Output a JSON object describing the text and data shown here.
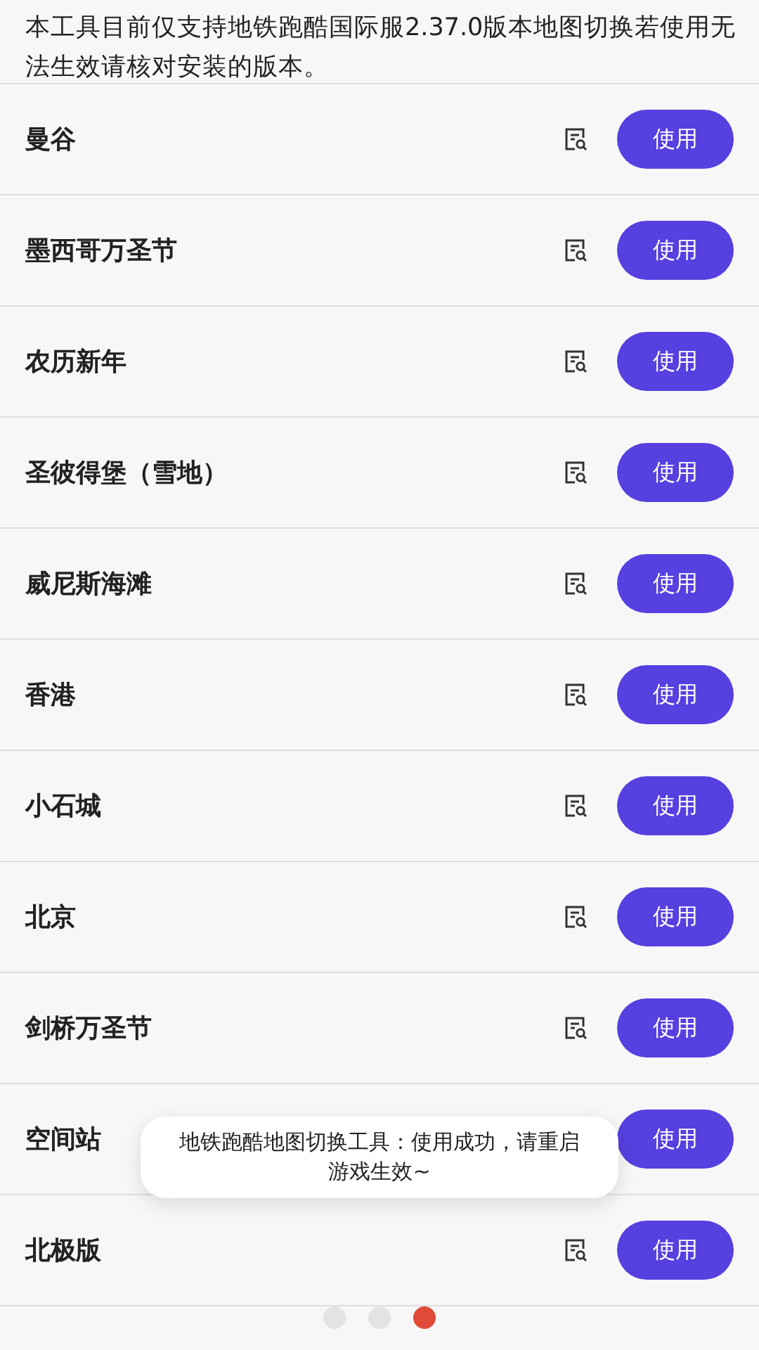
{
  "notice": "本工具目前仅支持地铁跑酷国际服2.37.0版本地图切换若使用无法生效请核对安装的版本。",
  "maps": [
    {
      "name": "曼谷",
      "preview": true,
      "button": "使用"
    },
    {
      "name": "墨西哥万圣节",
      "preview": true,
      "button": "使用"
    },
    {
      "name": "农历新年",
      "preview": true,
      "button": "使用"
    },
    {
      "name": "圣彼得堡（雪地）",
      "preview": true,
      "button": "使用"
    },
    {
      "name": "威尼斯海滩",
      "preview": true,
      "button": "使用"
    },
    {
      "name": "香港",
      "preview": true,
      "button": "使用"
    },
    {
      "name": "小石城",
      "preview": true,
      "button": "使用"
    },
    {
      "name": "北京",
      "preview": true,
      "button": "使用"
    },
    {
      "name": "剑桥万圣节",
      "preview": true,
      "button": "使用"
    },
    {
      "name": "空间站",
      "preview": false,
      "button": "使用"
    },
    {
      "name": "北极版",
      "preview": true,
      "button": "使用"
    }
  ],
  "toast": "地铁跑酷地图切换工具：使用成功，请重启游戏生效~",
  "pager": [
    {
      "selected": false
    },
    {
      "selected": false
    },
    {
      "selected": true
    }
  ]
}
